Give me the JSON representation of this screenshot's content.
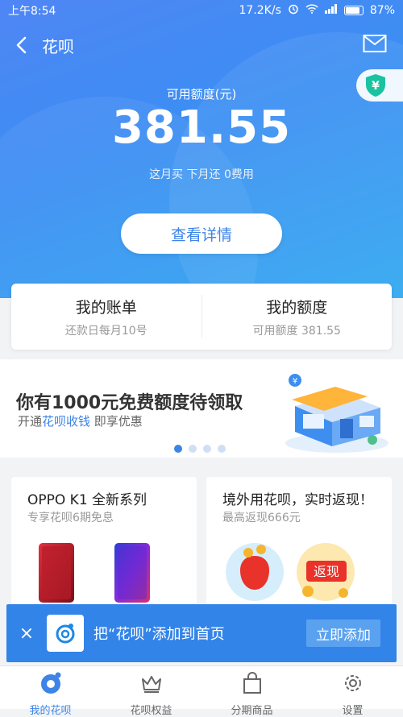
{
  "status_bar": {
    "time": "上午8:54",
    "network_speed": "17.2K/s",
    "battery": "87%"
  },
  "nav": {
    "title": "花呗"
  },
  "hero": {
    "available_label": "可用额度(元)",
    "amount": "381.55",
    "sub_info": "这月买 下月还 0费用",
    "detail_button": "查看详情",
    "shield_glyph": "¥"
  },
  "summary": {
    "bill_title": "我的账单",
    "bill_sub": "还款日每月10号",
    "quota_title": "我的额度",
    "quota_sub": "可用额度 381.55"
  },
  "banner": {
    "title": "你有1000元免费额度待领取",
    "sub_prefix": "开通",
    "sub_highlight": "花呗收钱",
    "sub_suffix": " 即享优惠",
    "page_count": 4,
    "active_index": 0
  },
  "promos": [
    {
      "title": "OPPO K1 全新系列",
      "sub": "专享花呗6期免息"
    },
    {
      "title": "境外用花呗，实时返现！",
      "sub": "最高返现666元",
      "badge": "返现"
    }
  ],
  "add_bar": {
    "close": "×",
    "text": "把“花呗”添加到首页",
    "button": "立即添加"
  },
  "tabs": [
    {
      "label": "我的花呗",
      "icon": "huabei-logo-icon"
    },
    {
      "label": "花呗权益",
      "icon": "crown-icon"
    },
    {
      "label": "分期商品",
      "icon": "shopping-bag-icon"
    },
    {
      "label": "设置",
      "icon": "gear-icon"
    }
  ],
  "colors": {
    "accent": "#3d84e6",
    "hero_start": "#4f86f5",
    "hero_end": "#2fa7f0",
    "add_bar": "#3384e8"
  }
}
